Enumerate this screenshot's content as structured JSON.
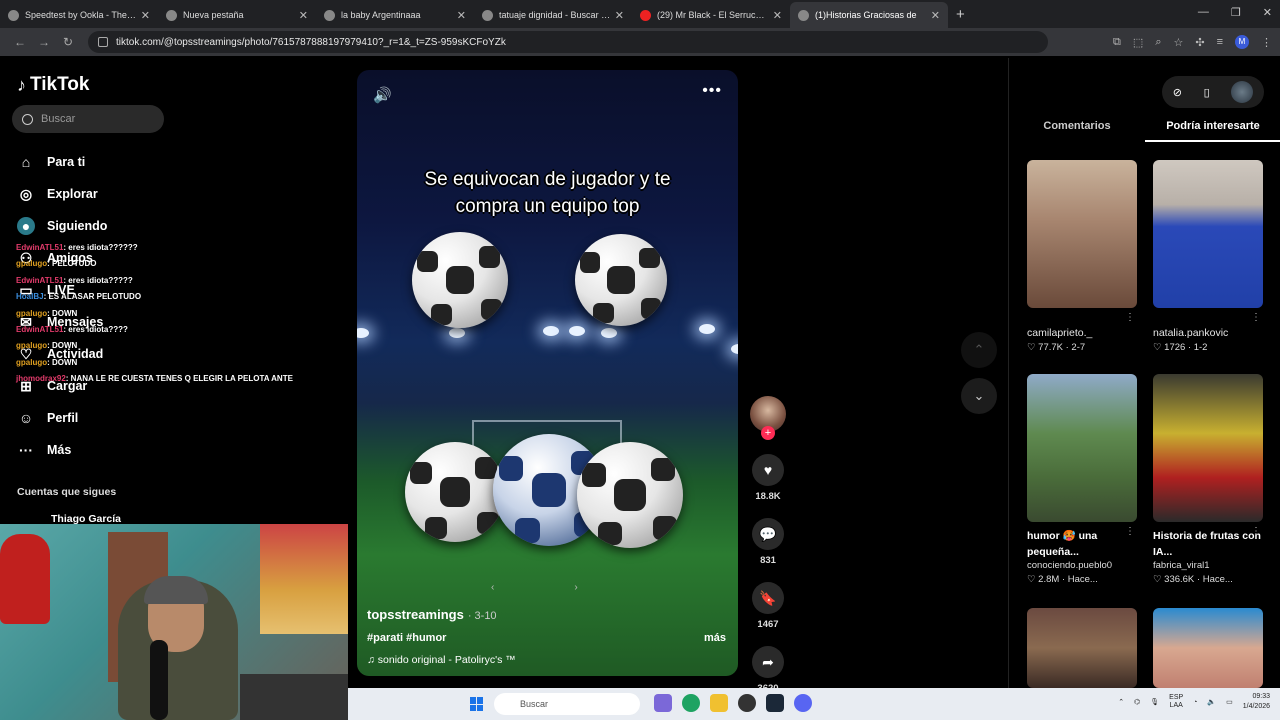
{
  "browser": {
    "tabs": [
      {
        "title": "Speedtest by Ookla - The Globa",
        "active": false
      },
      {
        "title": "Nueva pestaña",
        "active": false
      },
      {
        "title": "la baby Argentinaaa",
        "active": false
      },
      {
        "title": "tatuaje dignidad - Buscar con G",
        "active": false
      },
      {
        "title": "(29) Mr Black - El Serrucho [Of",
        "active": false
      },
      {
        "title": "(1)Historias Graciosas de",
        "active": true
      }
    ],
    "url": "tiktok.com/@topsstreamings/photo/7615787888197979410?_r=1&_t=ZS-959sKCFoYZk",
    "profile_initial": "M"
  },
  "sidebar": {
    "logo": "TikTok",
    "search_placeholder": "Buscar",
    "nav": [
      {
        "label": "Para ti",
        "icon": "home-icon"
      },
      {
        "label": "Explorar",
        "icon": "compass-icon"
      },
      {
        "label": "Siguiendo",
        "icon": "following-icon"
      },
      {
        "label": "Amigos",
        "icon": "friends-icon"
      },
      {
        "label": "LIVE",
        "icon": "live-icon"
      },
      {
        "label": "Mensajes",
        "icon": "message-icon"
      },
      {
        "label": "Actividad",
        "icon": "activity-icon"
      },
      {
        "label": "Cargar",
        "icon": "upload-icon"
      },
      {
        "label": "Perfil",
        "icon": "profile-icon"
      },
      {
        "label": "Más",
        "icon": "more-icon"
      }
    ],
    "following_header": "Cuentas que sigues",
    "following_user": "Thiago García"
  },
  "chat": [
    {
      "user": "EdwinATL51",
      "text": ": eres idiota??????"
    },
    {
      "user": "gpalugo",
      "text": ": PELOTUDO"
    },
    {
      "user": "EdwinATL51",
      "text": ": eres idiota?????"
    },
    {
      "user": "HoalBJ",
      "text": ": ES ALASAR PELOTUDO"
    },
    {
      "user": "gpalugo",
      "text": ": DOWN"
    },
    {
      "user": "EdwinATL51",
      "text": ": eres idiota????"
    },
    {
      "user": "gpalugo",
      "text": ": DOWN"
    },
    {
      "user": "gpalugo",
      "text": ": DOWN"
    },
    {
      "user": "jhomodrax92",
      "text": ": NANA LE RE CUESTA TENES Q ELEGIR LA PELOTA ANTE"
    }
  ],
  "video": {
    "caption_line1": "Se equivocan de jugador y te",
    "caption_line2": "compra un equipo top",
    "author": "topsstreamings",
    "date": "· 3-10",
    "tags": "#parati #humor",
    "more": "más",
    "sound": "sonido original - Patoliryc's ™"
  },
  "actions": {
    "likes": "18.8K",
    "comments": "831",
    "saves": "1467",
    "shares": "3620"
  },
  "right_panel": {
    "tabs": [
      "Comentarios",
      "Podría interesarte"
    ],
    "active_tab": 1,
    "cards": [
      {
        "user": "camilaprieto._",
        "stats": "♡ 77.7K · 2-7",
        "title": ""
      },
      {
        "user": "natalia.pankovic",
        "stats": "♡ 1726 · 1-2",
        "title": ""
      },
      {
        "title": "humor 🥵 una pequeña...",
        "user": "conociendo.pueblo0",
        "stats": "♡ 2.8M · Hace..."
      },
      {
        "title": "Historia de frutas con IA...",
        "user": "fabrica_viral1",
        "stats": "♡ 336.6K · Hace..."
      }
    ]
  },
  "taskbar": {
    "search_placeholder": "Buscar",
    "lang": "ESP",
    "lang2": "LAA",
    "time": "09:33",
    "date": "1/4/2026"
  }
}
